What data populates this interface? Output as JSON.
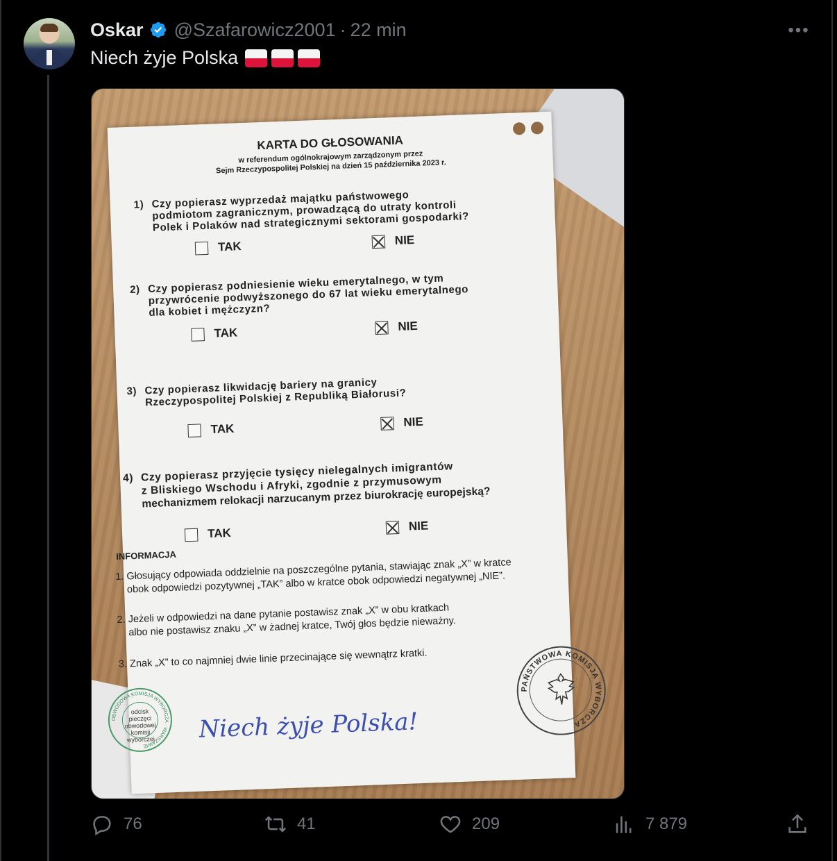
{
  "tweet": {
    "author_name": "Oskar",
    "handle": "@Szafarowicz2001",
    "separator": "·",
    "time": "22 min",
    "text": "Niech żyje Polska",
    "flag_count": 3
  },
  "media": {
    "ballot": {
      "title": "KARTA DO GŁOSOWANIA",
      "subtitle_line1": "w referendum ogólnokrajowym zarządzonym przez",
      "subtitle_line2": "Sejm Rzeczypospolitej Polskiej na dzień 15 października 2023 r.",
      "questions": [
        {
          "num": "1)",
          "line1": "Czy popierasz wyprzedaż majątku państwowego",
          "line2": "podmiotom zagranicznym, prowadzącą do utraty kontroli",
          "line3": "Polek i Polaków nad strategicznymi sektorami gospodarki?",
          "tak": "TAK",
          "nie": "NIE"
        },
        {
          "num": "2)",
          "line1": "Czy popierasz podniesienie wieku emerytalnego, w tym",
          "line2": "przywrócenie podwyższonego do 67 lat wieku emerytalnego",
          "line3": "dla kobiet i mężczyzn?",
          "tak": "TAK",
          "nie": "NIE"
        },
        {
          "num": "3)",
          "line1": "Czy popierasz likwidację bariery na granicy",
          "line2": "Rzeczypospolitej Polskiej z Republiką Białorusi?",
          "line3": "",
          "tak": "TAK",
          "nie": "NIE"
        },
        {
          "num": "4)",
          "line1": "Czy popierasz przyjęcie tysięcy nielegalnych imigrantów",
          "line2": "z Bliskiego Wschodu i Afryki, zgodnie z przymusowym",
          "line3": "mechanizmem relokacji narzucanym przez biurokrację europejską?",
          "tak": "TAK",
          "nie": "NIE"
        }
      ],
      "info_heading": "INFORMACJA",
      "info": [
        {
          "line1": "1. Głosujący odpowiada oddzielnie na poszczególne pytania, stawiając znak „X” w kratce",
          "line2": "obok odpowiedzi pozytywnej „TAK” albo w kratce obok odpowiedzi negatywnej „NIE”."
        },
        {
          "line1": "2. Jeżeli w odpowiedzi na dane pytanie postawisz znak „X” w obu kratkach",
          "line2": "albo nie postawisz znaku „X” w żadnej kratce, Twój głos będzie nieważny."
        },
        {
          "line1": "3. Znak „X” to co najmniej dwie linie przecinające się wewnątrz kratki.",
          "line2": ""
        }
      ],
      "stamp_left_ring": "OBWODOWA KOMISJA WYBORCZA · WARSZAWIE",
      "stamp_left_inner": [
        "odcisk",
        "pieczęci",
        "obwodowej",
        "komisji",
        "wyborczej"
      ],
      "stamp_right_ring": "PAŃSTWOWA KOMISJA WYBORCZA",
      "handwriting": "Niech żyje Polska!"
    }
  },
  "actions": {
    "replies": "76",
    "reposts": "41",
    "likes": "209",
    "views": "7 879"
  },
  "colors": {
    "background": "#000000",
    "text": "#e7e9ea",
    "muted": "#71767b",
    "verified": "#1d9bf0"
  }
}
